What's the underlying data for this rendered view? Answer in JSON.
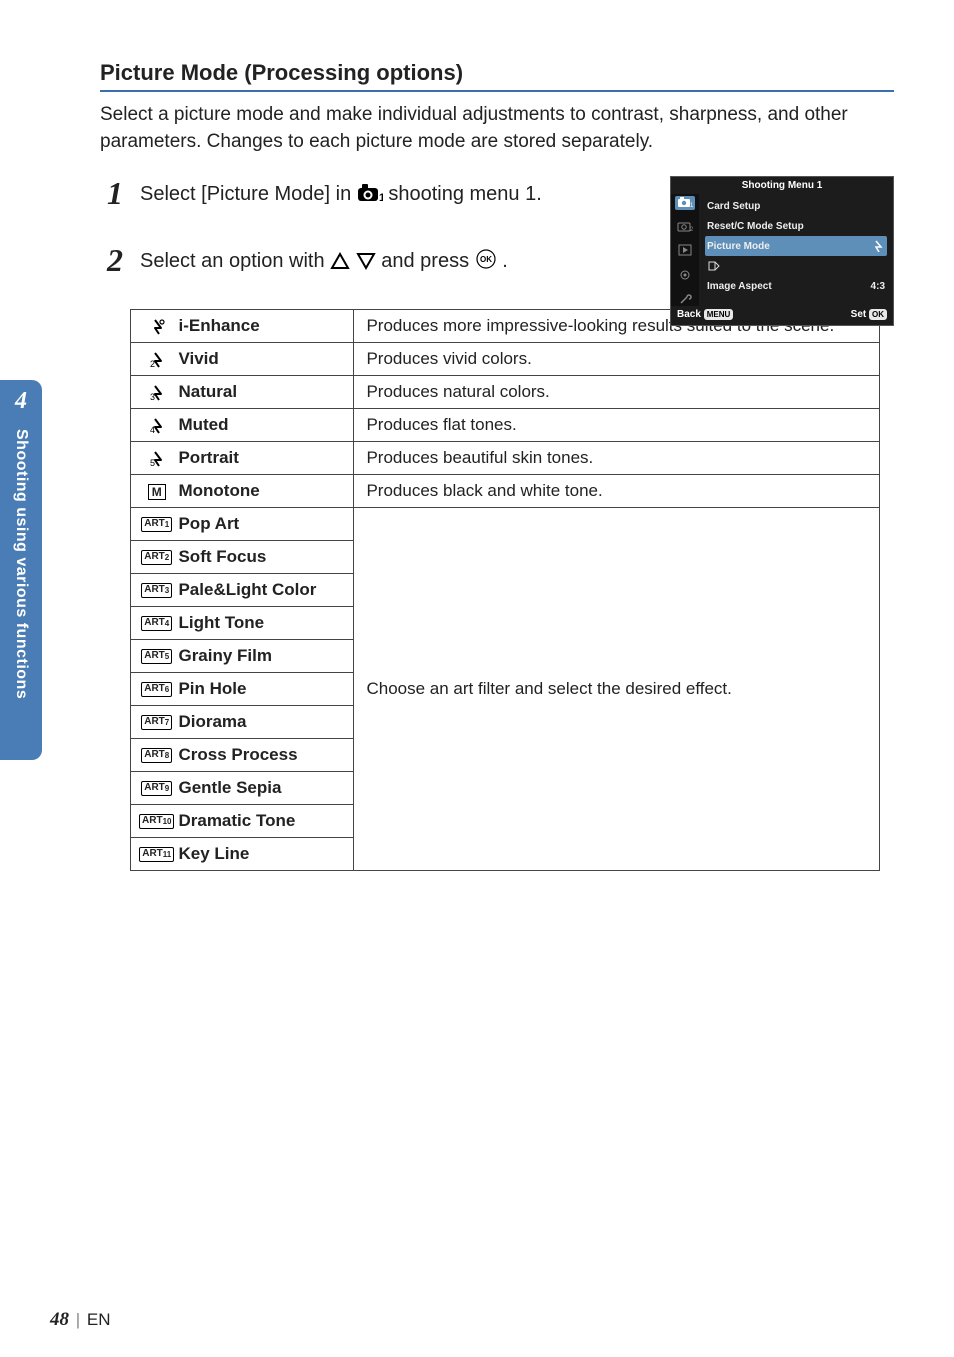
{
  "heading": "Picture Mode (Processing options)",
  "intro": "Select a picture mode and make individual adjustments to contrast, sharpness, and other parameters. Changes to each picture mode are stored separately.",
  "steps": {
    "s1": {
      "num": "1",
      "pre": "Select [Picture Mode] in ",
      "post": " shooting menu 1."
    },
    "s2": {
      "num": "2",
      "pre": "Select an option with ",
      "mid": " and press ",
      "post": "."
    }
  },
  "lcd": {
    "title": "Shooting Menu 1",
    "items": {
      "card": "Card Setup",
      "reset": "Reset/C Mode Setup",
      "pic": "Picture Mode",
      "qual": "",
      "aspect": "Image Aspect",
      "aspect_val": "4:3"
    },
    "foot": {
      "back": "Back",
      "back_btn": "MENU",
      "set": "Set",
      "set_btn": "OK"
    }
  },
  "table": {
    "rows": [
      {
        "icon_type": "pic",
        "icon_sub": "",
        "name": "i-Enhance",
        "desc": "Produces more impressive-looking results suited to the scene."
      },
      {
        "icon_type": "pic",
        "icon_sub": "2",
        "name": "Vivid",
        "desc": "Produces vivid colors."
      },
      {
        "icon_type": "pic",
        "icon_sub": "3",
        "name": "Natural",
        "desc": "Produces natural colors."
      },
      {
        "icon_type": "pic",
        "icon_sub": "4",
        "name": "Muted",
        "desc": "Produces flat tones."
      },
      {
        "icon_type": "pic",
        "icon_sub": "5",
        "name": "Portrait",
        "desc": "Produces beautiful skin tones."
      },
      {
        "icon_type": "mono",
        "icon_sub": "M",
        "name": "Monotone",
        "desc": "Produces black and white tone."
      },
      {
        "icon_type": "art",
        "icon_sub": "1",
        "name": "Pop Art",
        "desc_span": true
      },
      {
        "icon_type": "art",
        "icon_sub": "2",
        "name": "Soft Focus"
      },
      {
        "icon_type": "art",
        "icon_sub": "3",
        "name": "Pale&Light Color"
      },
      {
        "icon_type": "art",
        "icon_sub": "4",
        "name": "Light Tone"
      },
      {
        "icon_type": "art",
        "icon_sub": "5",
        "name": "Grainy Film"
      },
      {
        "icon_type": "art",
        "icon_sub": "6",
        "name": "Pin Hole"
      },
      {
        "icon_type": "art",
        "icon_sub": "7",
        "name": "Diorama"
      },
      {
        "icon_type": "art",
        "icon_sub": "8",
        "name": "Cross Process"
      },
      {
        "icon_type": "art",
        "icon_sub": "9",
        "name": "Gentle Sepia"
      },
      {
        "icon_type": "art",
        "icon_sub": "10",
        "name": "Dramatic Tone"
      },
      {
        "icon_type": "art",
        "icon_sub": "11",
        "name": "Key Line"
      }
    ],
    "art_desc": "Choose an art filter and select the desired effect."
  },
  "side": {
    "num": "4",
    "label": "Shooting using various functions"
  },
  "footer": {
    "page": "48",
    "lang": "EN"
  }
}
